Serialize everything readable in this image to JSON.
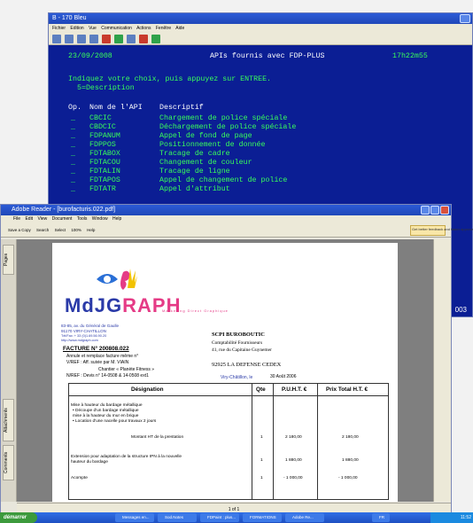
{
  "emulator": {
    "title": "B - 170 Bleu",
    "menu": [
      "Fichier",
      "Edition",
      "Vue",
      "Communication",
      "Actions",
      "Fenêtre",
      "Aide"
    ],
    "date": "23/09/2008",
    "heading": "APIs fournis avec FDP-PLUS",
    "time": "17h22m55",
    "instruction": "Indiquez votre choix, puis appuyez sur ENTREE.",
    "option": "5=Description",
    "col_op": "Op.",
    "col_name": "Nom de l'API",
    "col_desc": "Descriptif",
    "rows": [
      {
        "op": "_",
        "code": "CBCIC",
        "desc": "Chargement de police spéciale"
      },
      {
        "op": "_",
        "code": "CBDCIC",
        "desc": "Déchargement de police spéciale"
      },
      {
        "op": "_",
        "code": "FDPANUM",
        "desc": "Appel de fond de page"
      },
      {
        "op": "_",
        "code": "FDPPOS",
        "desc": "Positionnement de donnée"
      },
      {
        "op": "_",
        "code": "FDTABOX",
        "desc": "Tracage de cadre"
      },
      {
        "op": "_",
        "code": "FDTACOU",
        "desc": "Changement de couleur"
      },
      {
        "op": "_",
        "code": "FDTALIN",
        "desc": "Tracage de ligne"
      },
      {
        "op": "_",
        "code": "FDTAPOS",
        "desc": "Appel de changement de police"
      },
      {
        "op": "_",
        "code": "FDTATR",
        "desc": "Appel d'attribut"
      }
    ],
    "status_number": "003"
  },
  "reader": {
    "title": "Adobe Reader - [burofacturis.022.pdf]",
    "menu": [
      "File",
      "Edit",
      "View",
      "Document",
      "Tools",
      "Window",
      "Help"
    ],
    "toolbar": [
      "Save a Copy",
      "Search",
      "Select",
      "100%",
      "Help"
    ],
    "help_box": "Get better feedback and faster approvals",
    "side_tabs": [
      "Pages",
      "Attachments",
      "Comments"
    ],
    "page_nav": "1 of 1"
  },
  "invoice": {
    "brand_left": "MdJG",
    "brand_right": "RAPH",
    "brand_tagline": "Marketing Direct Graphique",
    "address": [
      "83-85, av. du Général de Gaulle",
      "91170 VIRY-CHATILLON",
      "Tél/Fax: + 33 (0)1.69.56.90.20",
      "http://www.mdgraph.com"
    ],
    "invoice_no": "FACTURE N° 200808.022",
    "annule": "Annule et remplace facture même n°",
    "vref": "V/REF : Aff. suivie par M. VIAIN",
    "chantier": "Chantier « Planète Fitness »",
    "nref": "N/REF : Devis n° 14-0508 & 14-0508 ext1",
    "recipient": [
      "SCPI BUROBOUTIC",
      "Comptabilité Fournisseurs",
      "41, rue du Capitaine Guynemer"
    ],
    "city": "92925 LA DEFENSE CEDEX",
    "place_date_prefix": "Viry-Châtillon, le",
    "place_date": "30 Août 2006",
    "table": {
      "headers": [
        "Désignation",
        "Qte",
        "P.U.H.T. €",
        "Prix Total H.T. €"
      ],
      "lines": [
        "Mise à hauteur du bardage métallique",
        "• Découpe d'un bardage métallique",
        "   mise à la hauteur du mur en brique",
        "• Location d'une nacelle pour travaux 2 jours"
      ],
      "subtotal_label": "Montant HT de la prestation",
      "subtotal": {
        "qty": "1",
        "pu": "2 180,00",
        "total": "2 180,00"
      },
      "ext_label1": "Extension pour adaptation de la structure IPN à la nouvelle",
      "ext_label2": "hauteur du bardage",
      "ext": {
        "qty": "1",
        "pu": "1 880,00",
        "total": "1 880,00"
      },
      "acompte_label": "Acompte",
      "acompte": {
        "qty": "1",
        "pu": "- 1 000,00",
        "total": "- 1 000,00"
      }
    }
  },
  "taskbar": {
    "start": "démarrer",
    "items": [
      "Messages en...",
      "Sod.Notes",
      "FDPaint : plus...",
      "FORMATIONS",
      "Adobe Re...",
      "FR"
    ],
    "clock": "11:52"
  }
}
